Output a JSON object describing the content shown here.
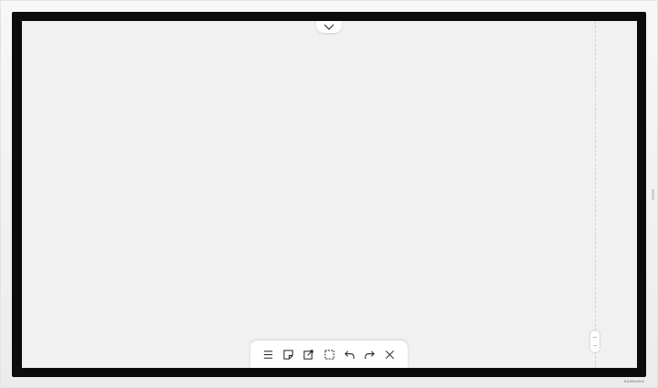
{
  "device": {
    "camera_label": "",
    "brand": "SAMSUNG"
  },
  "screen": {
    "background": "#f1f1f1",
    "bezel_color": "#0c0c0c"
  },
  "top_tab": {
    "icon": "chevron-down-icon"
  },
  "toolbar": {
    "tools": [
      {
        "name": "menu",
        "icon": "menu-icon"
      },
      {
        "name": "sticky-note",
        "icon": "sticky-note-icon"
      },
      {
        "name": "import-note",
        "icon": "import-note-icon"
      },
      {
        "name": "select",
        "icon": "select-area-icon"
      },
      {
        "name": "undo",
        "icon": "undo-icon"
      },
      {
        "name": "redo",
        "icon": "redo-icon"
      },
      {
        "name": "close",
        "icon": "close-icon"
      }
    ]
  }
}
